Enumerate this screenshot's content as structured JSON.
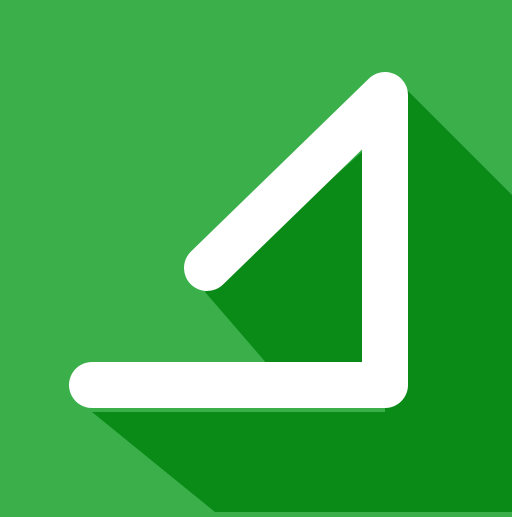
{
  "icon": {
    "name": "angle-icon",
    "colors": {
      "background": "#3aaf4a",
      "shadow": "#0a8a17",
      "glyph": "#ffffff"
    }
  }
}
